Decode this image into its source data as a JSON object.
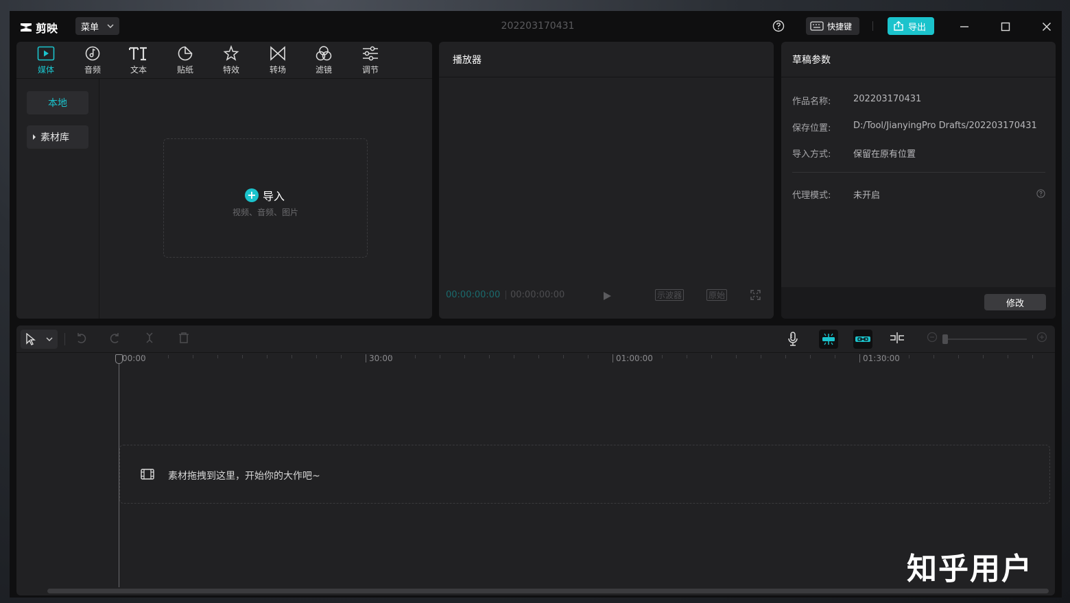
{
  "app": {
    "logo_text": "剪映",
    "menu_label": "菜单",
    "project_title": "202203170431",
    "shortcut_label": "快捷键",
    "export_label": "导出"
  },
  "media_panel": {
    "tabs": [
      {
        "label": "媒体",
        "icon": "media-icon",
        "active": true
      },
      {
        "label": "音频",
        "icon": "audio-icon",
        "active": false
      },
      {
        "label": "文本",
        "icon": "text-icon",
        "active": false
      },
      {
        "label": "贴纸",
        "icon": "sticker-icon",
        "active": false
      },
      {
        "label": "特效",
        "icon": "effects-icon",
        "active": false
      },
      {
        "label": "转场",
        "icon": "transition-icon",
        "active": false
      },
      {
        "label": "滤镜",
        "icon": "filter-icon",
        "active": false
      },
      {
        "label": "调节",
        "icon": "adjust-icon",
        "active": false
      }
    ],
    "sidebar": [
      {
        "label": "本地",
        "active": true
      },
      {
        "label": "素材库",
        "active": false
      }
    ],
    "import": {
      "title": "导入",
      "subtitle": "视频、音频、图片"
    }
  },
  "player": {
    "title": "播放器",
    "current_time": "00:00:00:00",
    "total_time": "00:00:00:00",
    "waveform_btn": "示波器",
    "original_btn": "原始"
  },
  "draft_params": {
    "title": "草稿参数",
    "rows": [
      {
        "key": "作品名称:",
        "value": "202203170431"
      },
      {
        "key": "保存位置:",
        "value": "D:/Tool/JianyingPro Drafts/202203170431"
      },
      {
        "key": "导入方式:",
        "value": "保留在原有位置"
      }
    ],
    "proxy": {
      "key": "代理模式:",
      "value": "未开启"
    },
    "modify_label": "修改"
  },
  "timeline": {
    "ruler_labels": [
      "00:00",
      "30:00",
      "01:00:00",
      "01:30:00"
    ],
    "drop_hint": "素材拖拽到这里，开始你的大作吧~"
  },
  "watermark": "知乎用户",
  "colors": {
    "accent": "#1bc3cc",
    "panel": "#212123",
    "background": "#0f0f10"
  }
}
